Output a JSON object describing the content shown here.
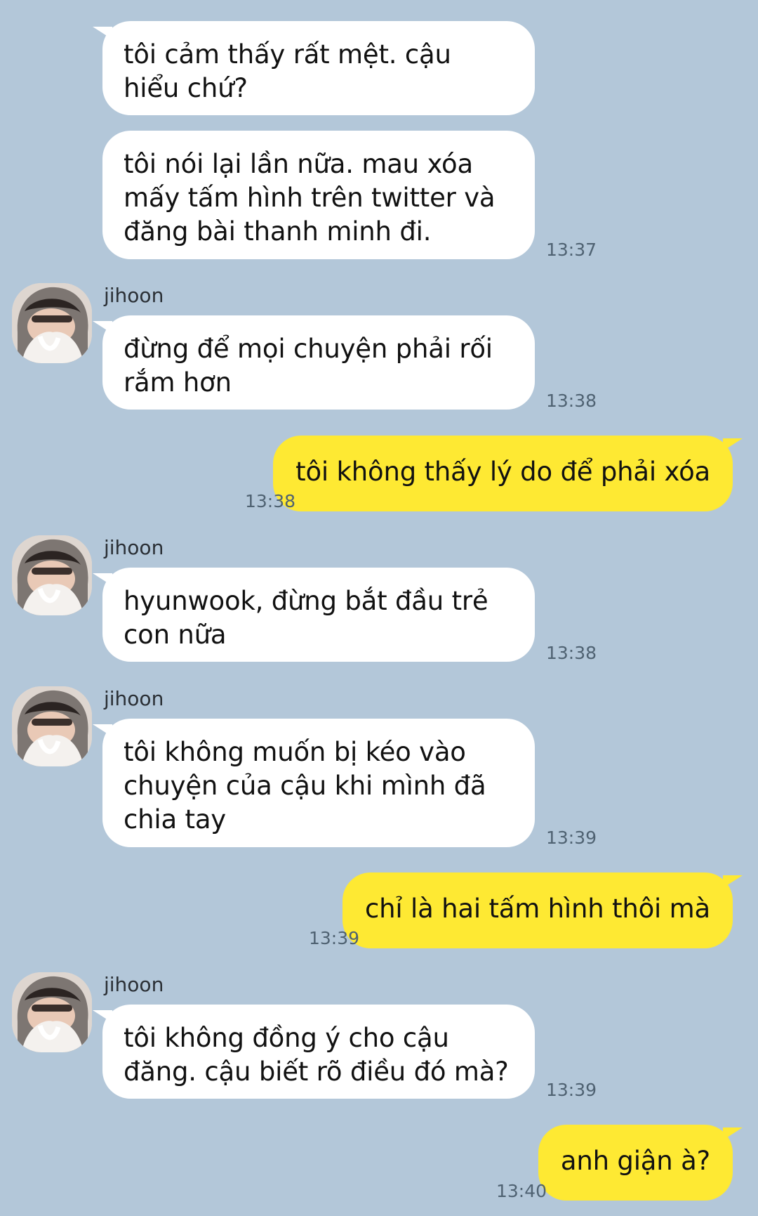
{
  "chat": {
    "messages": [
      {
        "side": "in",
        "text": "tôi cảm thấy rất mệt. cậu hiểu chứ?"
      },
      {
        "side": "in",
        "text": "tôi nói lại lần nữa. mau xóa mấy tấm hình trên twitter và đăng bài thanh minh đi.",
        "time": "13:37"
      },
      {
        "side": "in",
        "sender": "jihoon",
        "avatar": "contact-avatar",
        "text": "đừng để mọi chuyện phải rối rắm hơn",
        "time": "13:38"
      },
      {
        "side": "out",
        "text": "tôi không thấy lý do để phải xóa",
        "time": "13:38"
      },
      {
        "side": "in",
        "sender": "jihoon",
        "avatar": "contact-avatar",
        "text": "hyunwook, đừng bắt đầu trẻ con nữa",
        "time": "13:38"
      },
      {
        "side": "in",
        "sender": "jihoon",
        "avatar": "contact-avatar",
        "text": "tôi không muốn bị kéo vào chuyện của cậu khi mình đã chia tay",
        "time": "13:39"
      },
      {
        "side": "out",
        "text": "chỉ là hai tấm hình thôi mà",
        "time": "13:39"
      },
      {
        "side": "in",
        "sender": "jihoon",
        "avatar": "contact-avatar",
        "text": "tôi không đồng ý cho cậu đăng. cậu biết rõ điều đó mà?",
        "time": "13:39"
      },
      {
        "side": "out",
        "text": "anh giận à?",
        "time": "13:40"
      }
    ]
  },
  "colors": {
    "background": "#b3c7d9",
    "incoming_bubble": "#ffffff",
    "outgoing_bubble": "#fee933",
    "timestamp": "#4f6272"
  }
}
